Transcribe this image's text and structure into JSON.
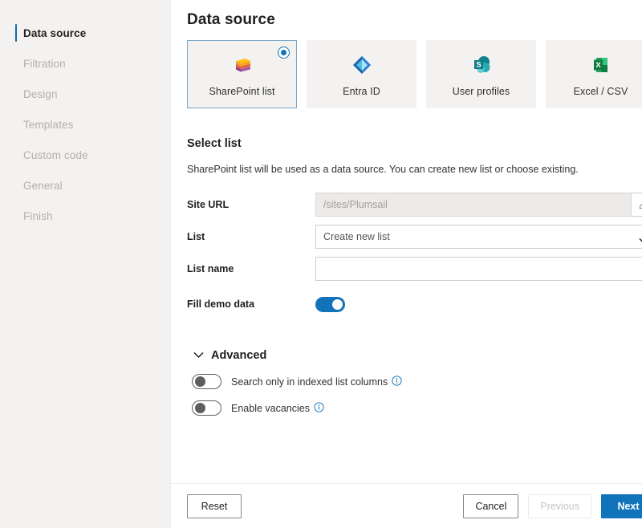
{
  "sidebar": {
    "items": [
      {
        "label": "Data source",
        "active": true
      },
      {
        "label": "Filtration",
        "active": false
      },
      {
        "label": "Design",
        "active": false
      },
      {
        "label": "Templates",
        "active": false
      },
      {
        "label": "Custom code",
        "active": false
      },
      {
        "label": "General",
        "active": false
      },
      {
        "label": "Finish",
        "active": false
      }
    ]
  },
  "page": {
    "title": "Data source"
  },
  "sources": {
    "cards": [
      {
        "label": "SharePoint list",
        "icon": "sharepoint-list-icon",
        "selected": true
      },
      {
        "label": "Entra ID",
        "icon": "entra-id-icon",
        "selected": false
      },
      {
        "label": "User profiles",
        "icon": "user-profiles-icon",
        "selected": false
      },
      {
        "label": "Excel / CSV",
        "icon": "excel-csv-icon",
        "selected": false
      }
    ]
  },
  "select_list": {
    "title": "Select list",
    "description": "SharePoint list will be used as a data source. You can create new list or choose existing.",
    "site_url": {
      "label": "Site URL",
      "value": "/sites/Plumsail",
      "disabled": true,
      "edit_icon": "pencil-icon"
    },
    "list": {
      "label": "List",
      "value": "Create new list"
    },
    "list_name": {
      "label": "List name",
      "value": "",
      "placeholder": ""
    },
    "fill_demo_data": {
      "label": "Fill demo data",
      "state": "on"
    }
  },
  "advanced": {
    "title": "Advanced",
    "expanded": true,
    "chevron_icon": "chevron-down-icon",
    "options": [
      {
        "label": "Search only in indexed list columns",
        "state": "off",
        "info_icon": "info-icon"
      },
      {
        "label": "Enable vacancies",
        "state": "off",
        "info_icon": "info-icon"
      }
    ]
  },
  "footer": {
    "reset": "Reset",
    "cancel": "Cancel",
    "previous": "Previous",
    "next": "Next"
  },
  "colors": {
    "accent": "#1173ba",
    "sidebar_bg": "#f3f2f1",
    "card_bg": "#f3f2f1",
    "selected_border": "#7aa7c7"
  }
}
